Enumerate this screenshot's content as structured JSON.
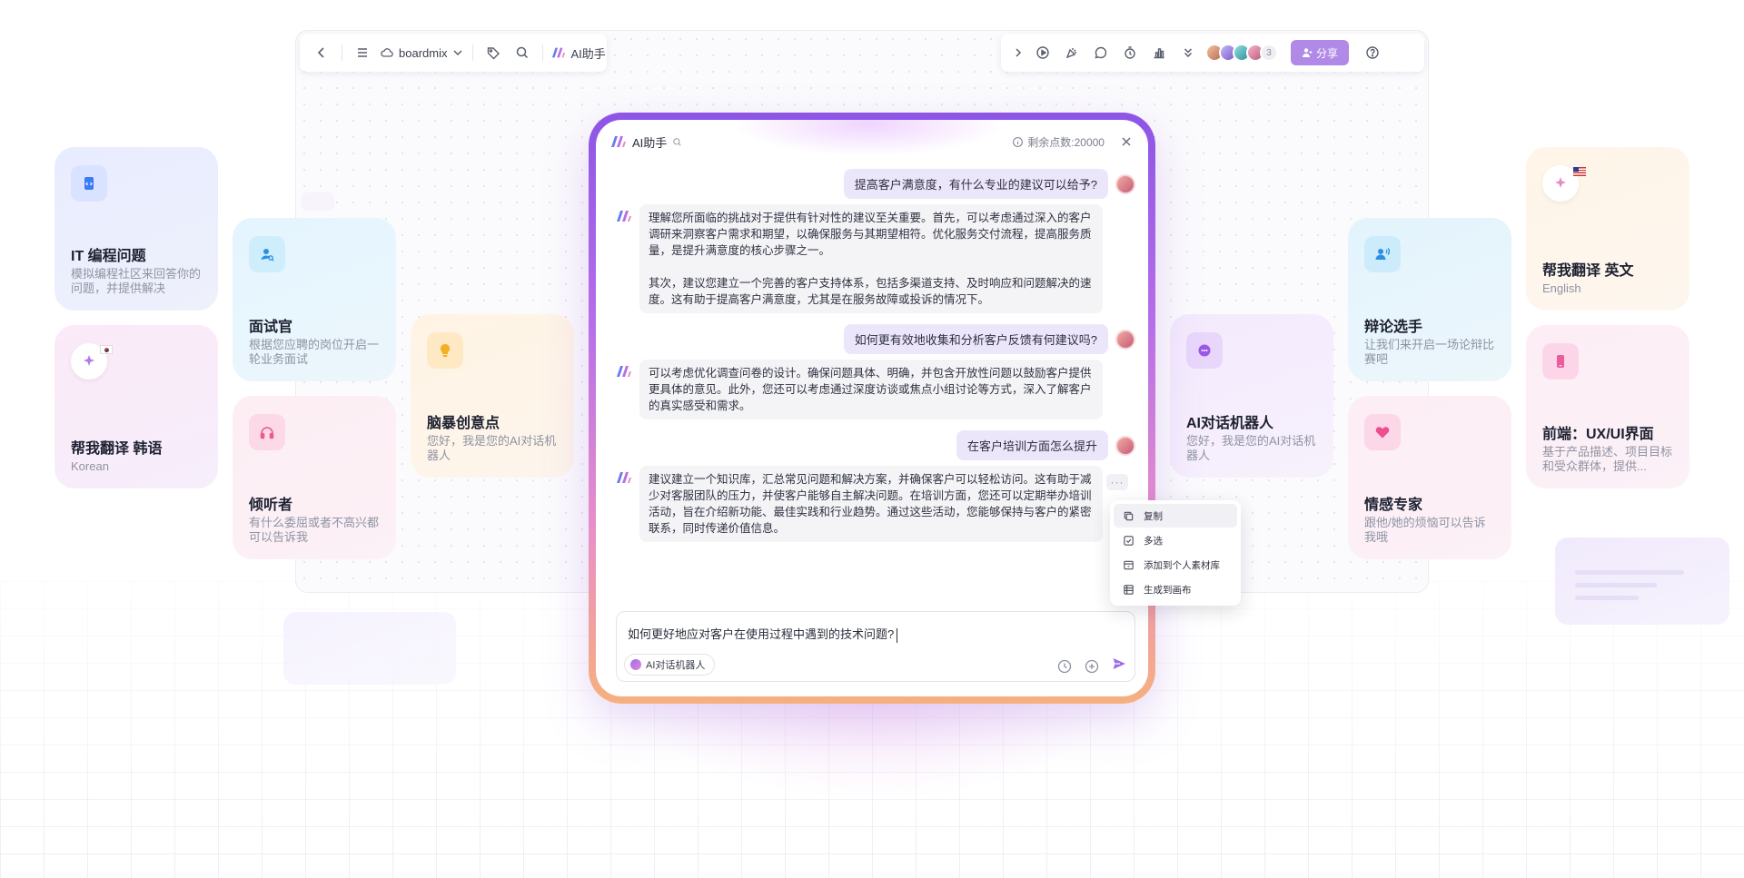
{
  "toolbar": {
    "brand_label": "boardmix",
    "ai_label": "AI助手",
    "share_label": "分享",
    "participant_count": "3"
  },
  "cards": {
    "it": {
      "title": "IT 编程问题",
      "desc": "模拟编程社区来回答你的问题，并提供解决"
    },
    "korean": {
      "title": "帮我翻译 韩语",
      "desc": "Korean"
    },
    "interviewer": {
      "title": "面试官",
      "desc": "根据您应聘的岗位开启一轮业务面试"
    },
    "listener": {
      "title": "倾听者",
      "desc": "有什么委屈或者不高兴都可以告诉我"
    },
    "brainstorm": {
      "title": "脑暴创意点",
      "desc": "您好，我是您的AI对话机器人"
    },
    "chatbot": {
      "title": "AI对话机器人",
      "desc": "您好，我是您的AI对话机器人"
    },
    "debater": {
      "title": "辩论选手",
      "desc": "让我们来开启一场论辩比赛吧"
    },
    "emotion": {
      "title": "情感专家",
      "desc": "跟他/她的烦恼可以告诉我哦"
    },
    "english": {
      "title": "帮我翻译 英文",
      "desc": "English"
    },
    "frontend": {
      "title": "前端：UX/UI界面",
      "desc": "基于产品描述、项目目标和受众群体，提供..."
    }
  },
  "chat": {
    "title": "AI助手",
    "credits": "剩余点数:20000",
    "messages": {
      "u1": "提高客户满意度，有什么专业的建议可以给予?",
      "a1p1": "理解您所面临的挑战对于提供有针对性的建议至关重要。首先，可以考虑通过深入的客户调研来洞察客户需求和期望，以确保服务与其期望相符。优化服务交付流程，提高服务质量，是提升满意度的核心步骤之一。",
      "a1p2": "其次，建议您建立一个完善的客户支持体系，包括多渠道支持、及时响应和问题解决的速度。这有助于提高客户满意度，尤其是在服务故障或投诉的情况下。",
      "u2": "如何更有效地收集和分析客户反馈有何建议吗?",
      "a2": "可以考虑优化调查问卷的设计。确保问题具体、明确，并包含开放性问题以鼓励客户提供更具体的意见。此外，您还可以考虑通过深度访谈或焦点小组讨论等方式，深入了解客户的真实感受和需求。",
      "u3": "在客户培训方面怎么提升",
      "a3": "建议建立一个知识库，汇总常见问题和解决方案，并确保客户可以轻松访问。这有助于减少对客服团队的压力，并使客户能够自主解决问题。在培训方面，您还可以定期举办培训活动，旨在介绍新功能、最佳实践和行业趋势。通过这些活动，您能够保持与客户的紧密联系，同时传递价值信息。"
    },
    "more_label": "···",
    "context_menu": [
      "复制",
      "多选",
      "添加到个人素材库",
      "生成到画布"
    ],
    "input_value": "如何更好地应对客户在使用过程中遇到的技术问题?",
    "chip_label": "AI对话机器人"
  },
  "colors": {
    "accent": "#9a6cf0",
    "share": "#b08ae6",
    "user_bubble": "#ece6fb"
  }
}
